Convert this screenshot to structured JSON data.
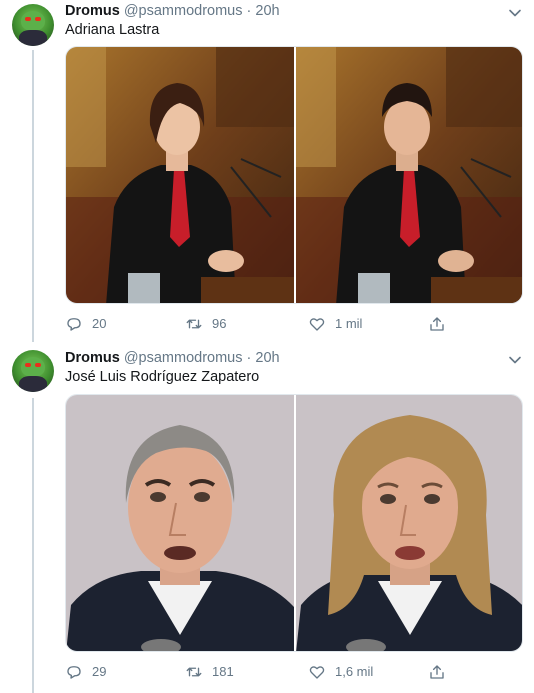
{
  "tweets": [
    {
      "author_name": "Dromus",
      "handle": "@psammodromus",
      "separator": "·",
      "time": "20h",
      "text": "Adriana Lastra",
      "replies": "20",
      "retweets": "96",
      "likes": "1 mil"
    },
    {
      "author_name": "Dromus",
      "handle": "@psammodromus",
      "separator": "·",
      "time": "20h",
      "text": "José Luis Rodríguez Zapatero",
      "replies": "29",
      "retweets": "181",
      "likes": "1,6 mil"
    }
  ],
  "icons": {
    "reply": "reply-icon",
    "retweet": "retweet-icon",
    "like": "heart-icon",
    "share": "share-icon",
    "more": "chevron-down-icon"
  },
  "colors": {
    "secondary_text": "#657786",
    "primary_text": "#14171a",
    "thread_line": "#ccd6dd"
  }
}
